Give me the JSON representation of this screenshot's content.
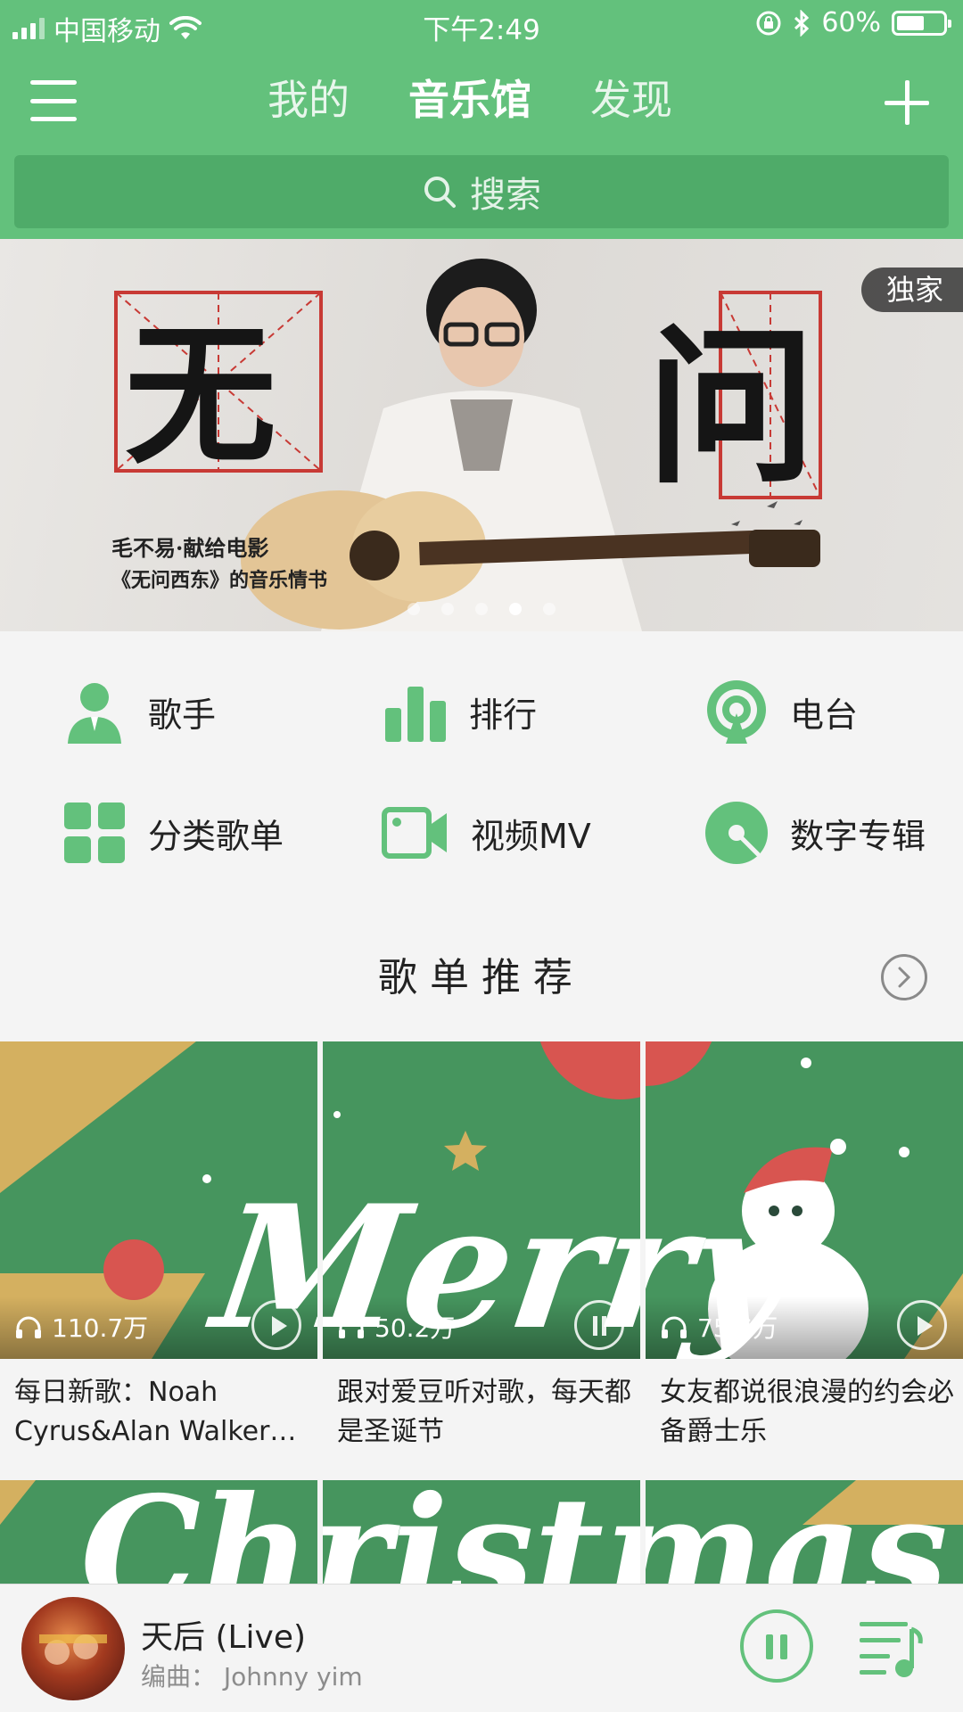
{
  "status_bar": {
    "carrier": "中国移动",
    "time": "下午2:49",
    "battery": "60%"
  },
  "nav": {
    "tabs": [
      {
        "label": "我的",
        "active": false
      },
      {
        "label": "音乐馆",
        "active": true
      },
      {
        "label": "发现",
        "active": false
      }
    ]
  },
  "search": {
    "placeholder": "搜索"
  },
  "banner": {
    "badge": "独家",
    "char_left": "无",
    "char_right": "问",
    "caption_line1": "毛不易·献给电影",
    "caption_line2": "《无问西东》的音乐情书",
    "slide_count": 5,
    "active_slide": 3
  },
  "categories": [
    {
      "label": "歌手",
      "icon": "singer-icon"
    },
    {
      "label": "排行",
      "icon": "chart-icon"
    },
    {
      "label": "电台",
      "icon": "radio-icon"
    },
    {
      "label": "分类歌单",
      "icon": "category-icon"
    },
    {
      "label": "视频MV",
      "icon": "video-icon"
    },
    {
      "label": "数字专辑",
      "icon": "album-icon"
    }
  ],
  "section": {
    "title": "歌单推荐"
  },
  "playlists": [
    {
      "plays": "110.7万",
      "title": "每日新歌：Noah Cyrus&Alan Walker…"
    },
    {
      "plays": "50.2万",
      "title": "跟对爱豆听对歌，每天都是圣诞节"
    },
    {
      "plays": "75.6万",
      "title": "女友都说很浪漫的约会必备爵士乐"
    }
  ],
  "artwork_text": {
    "row1": "Merry",
    "row2": "Christmas"
  },
  "now_playing": {
    "song": "天后 (Live)",
    "credit": "编曲： Johnny yim"
  },
  "colors": {
    "brand_green": "#63c17c",
    "search_green": "#4fab69",
    "card_green": "#46955e",
    "card_gold": "#d4b060",
    "card_red": "#d85550"
  }
}
